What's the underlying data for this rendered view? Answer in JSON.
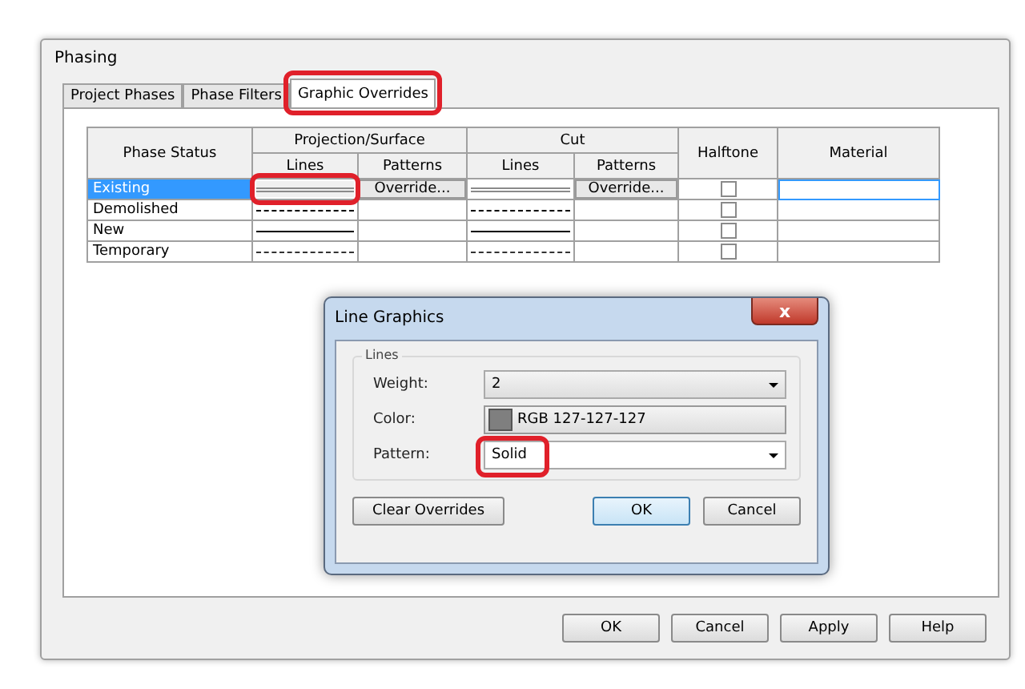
{
  "window": {
    "title": "Phasing"
  },
  "tabs": [
    {
      "label": "Project Phases",
      "selected": false,
      "highlighted": false
    },
    {
      "label": "Phase Filters",
      "selected": false,
      "highlighted": false
    },
    {
      "label": "Graphic Overrides",
      "selected": true,
      "highlighted": true
    }
  ],
  "table": {
    "columns": {
      "status": "Phase Status",
      "projection": "Projection/Surface",
      "cut": "Cut",
      "projection_lines": "Lines",
      "projection_patterns": "Patterns",
      "cut_lines": "Lines",
      "cut_patterns": "Patterns",
      "halftone": "Halftone",
      "material": "Material"
    },
    "rows": [
      {
        "status": "Existing",
        "selected": true,
        "projection_lines": {
          "kind": "gray",
          "highlighted": true
        },
        "projection_patterns": "Override...",
        "cut_lines": {
          "kind": "gray"
        },
        "cut_patterns": "Override...",
        "halftone": false
      },
      {
        "status": "Demolished",
        "selected": false,
        "projection_lines": {
          "kind": "dashed",
          "highlighted": false
        },
        "cut_lines": {
          "kind": "dashed"
        },
        "halftone": false
      },
      {
        "status": "New",
        "selected": false,
        "projection_lines": {
          "kind": "solid",
          "highlighted": false
        },
        "cut_lines": {
          "kind": "solid"
        },
        "halftone": false
      },
      {
        "status": "Temporary",
        "selected": false,
        "projection_lines": {
          "kind": "dotted",
          "highlighted": false
        },
        "cut_lines": {
          "kind": "dotted"
        },
        "halftone": false
      }
    ]
  },
  "line_graphics": {
    "title": "Line Graphics",
    "close": "x",
    "group": "Lines",
    "weight": {
      "label": "Weight:",
      "value": "2"
    },
    "color": {
      "label": "Color:",
      "value": "RGB 127-127-127",
      "swatch": {
        "color": "#7f7f7f"
      }
    },
    "pattern": {
      "label": "Pattern:",
      "value": "Solid",
      "highlighted": true
    },
    "buttons": [
      "Clear Overrides",
      "OK",
      "Cancel"
    ]
  },
  "buttons": [
    "OK",
    "Cancel",
    "Apply",
    "Help"
  ]
}
